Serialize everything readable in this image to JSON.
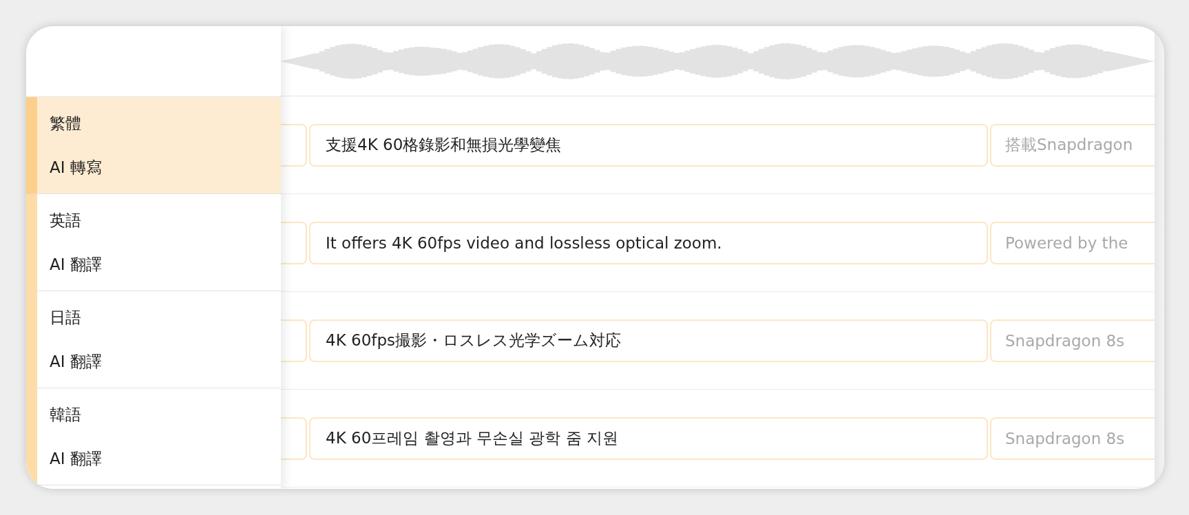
{
  "languages": [
    {
      "name": "繁體",
      "mode": "AI 轉寫",
      "selected": true
    },
    {
      "name": "英語",
      "mode": "AI 翻譯",
      "selected": false
    },
    {
      "name": "日語",
      "mode": "AI 翻譯",
      "selected": false
    },
    {
      "name": "韓語",
      "mode": "AI 翻譯",
      "selected": false
    }
  ],
  "segments": [
    {
      "text": "支援4K 60格錄影和無損光學變焦",
      "next_text": "搭載Snapdragon"
    },
    {
      "text": "It offers 4K 60fps video and lossless optical zoom.",
      "next_text": "Powered by the"
    },
    {
      "text": "4K 60fps撮影・ロスレス光学ズーム対応",
      "next_text": "Snapdragon 8s"
    },
    {
      "text": "4K 60프레임 촬영과 무손실 광학 줌 지원",
      "next_text": "Snapdragon 8s"
    }
  ]
}
